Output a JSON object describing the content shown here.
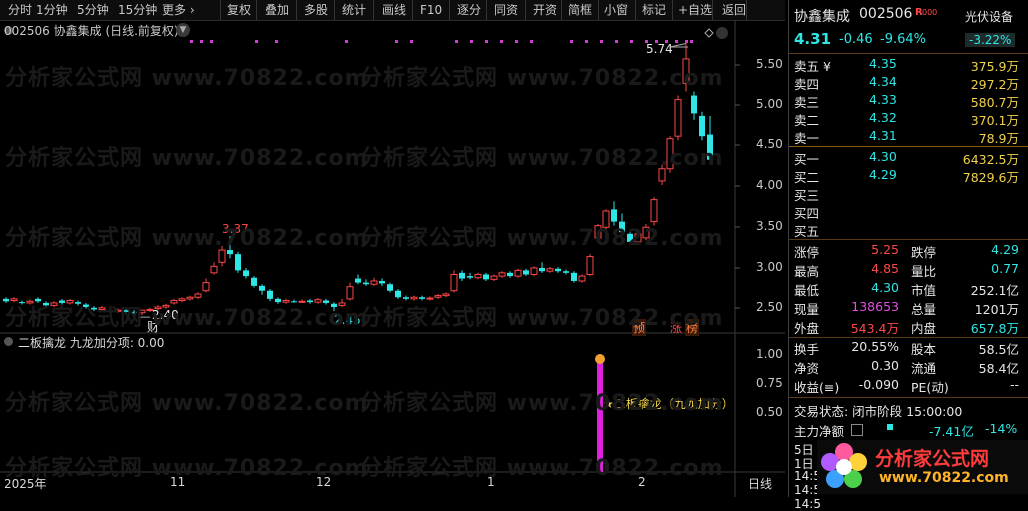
{
  "toolbar": {
    "items": [
      "分时",
      "1分钟",
      "5分钟",
      "15分钟",
      "更多 ›",
      "复权",
      "叠加",
      "多股",
      "统计",
      "画线",
      "F10",
      "逐分",
      "同资",
      "开资",
      "简框",
      "小窗",
      "标记",
      "+自选",
      "返回"
    ]
  },
  "chart": {
    "title": "002506 协鑫集成 (日线.前复权)",
    "price_axis": [
      "5.50",
      "5.00",
      "4.50",
      "4.00",
      "3.50",
      "3.00",
      "2.50"
    ],
    "annotations": {
      "high1": "3.37",
      "high2": "5.74",
      "low1": "2.40",
      "low2": "2.45",
      "marker_cai": "财",
      "marker_yu": "预",
      "marker_zhang": "涨",
      "marker_bang": "榜"
    },
    "watermark": "分析家公式网 www.70822.com"
  },
  "indicator": {
    "title": "二板擒龙 九龙加分项: 0.00",
    "axis": [
      "1.00",
      "0.75",
      "0.50"
    ],
    "label": "★二板擒龙（九龙加分）"
  },
  "time_axis": {
    "labels": [
      "2025年",
      "11",
      "12",
      "1",
      "2"
    ],
    "period": "日线"
  },
  "stock": {
    "name": "协鑫集成",
    "code": "002506",
    "tag": "R",
    "tag2": "000",
    "sector": "光伏设备",
    "sector_change": "-3.22%",
    "price": "4.31",
    "change": "-0.46",
    "change_pct": "-9.64%"
  },
  "order_book": {
    "sell": [
      {
        "label": "卖五 ¥",
        "price": "4.35",
        "vol": "375.9万"
      },
      {
        "label": "卖四",
        "price": "4.34",
        "vol": "297.2万"
      },
      {
        "label": "卖三",
        "price": "4.33",
        "vol": "580.7万"
      },
      {
        "label": "卖二",
        "price": "4.32",
        "vol": "370.1万"
      },
      {
        "label": "卖一",
        "price": "4.31",
        "vol": "78.9万"
      }
    ],
    "buy": [
      {
        "label": "买一",
        "price": "4.30",
        "vol": "6432.5万"
      },
      {
        "label": "买二",
        "price": "4.29",
        "vol": "7829.6万"
      },
      {
        "label": "买三",
        "price": "",
        "vol": ""
      },
      {
        "label": "买四",
        "price": "",
        "vol": ""
      },
      {
        "label": "买五",
        "price": "",
        "vol": ""
      }
    ]
  },
  "stats": {
    "zt_label": "涨停",
    "zt": "5.25",
    "dt_label": "跌停",
    "dt": "4.29",
    "high_label": "最高",
    "high": "4.85",
    "lb_label": "量比",
    "lb": "0.77",
    "low_label": "最低",
    "low": "4.30",
    "sz_label": "市值",
    "sz": "252.1亿",
    "xl_label": "现量",
    "xl": "138653",
    "zl_label": "总量",
    "zl": "1201万",
    "wp_label": "外盘",
    "wp": "543.4万",
    "np_label": "内盘",
    "np": "657.8万",
    "hs_label": "换手",
    "hs": "20.55%",
    "gb_label": "股本",
    "gb": "58.5亿",
    "jz_label": "净资",
    "jz": "0.30",
    "lt_label": "流通",
    "lt": "58.4亿",
    "sy_label": "收益(≡)",
    "sy": "-0.090",
    "pe_label": "PE(动)",
    "pe": "--"
  },
  "trade_status": "交易状态: 闭市阶段 15:00:00",
  "main_net": {
    "label": "主力净额",
    "value": "-7.41亿",
    "pct": "-14%"
  },
  "bottom_rows": [
    "5日",
    "1日",
    "14:5",
    "14:5",
    "14:5"
  ],
  "logo": {
    "text": "分析家公式网",
    "url": "www.70822.com"
  },
  "colors": {
    "up": "#ff4646",
    "down": "#2ee6e6",
    "accent": "#f0d24a",
    "indicator": "#e020e0",
    "dots": "#d040d0"
  }
}
